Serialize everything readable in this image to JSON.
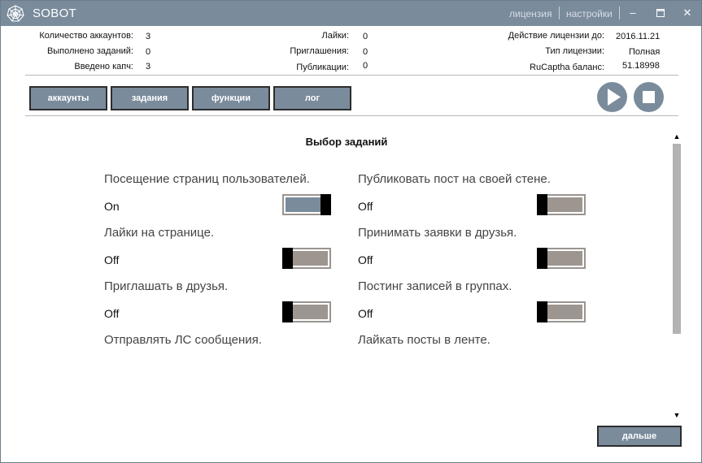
{
  "window": {
    "title": "SOBOT",
    "links": {
      "license": "лицензия",
      "settings": "настройки"
    }
  },
  "stats": {
    "accounts_label": "Количество аккаунтов:",
    "accounts_value": "3",
    "tasks_done_label": "Выполнено заданий:",
    "tasks_done_value": "0",
    "captchas_label": "Введено капч:",
    "captchas_value": "3",
    "likes_label": "Лайки:",
    "likes_value": "0",
    "invites_label": "Приглашения:",
    "invites_value": "0",
    "posts_label": "Публикации:",
    "posts_value": "0",
    "license_until_label": "Действие лицензии до:",
    "license_until_value": "2016.11.21",
    "license_type_label": "Тип лицензии:",
    "license_type_value": "Полная",
    "rucaptcha_label": "RuCaptha баланс:",
    "rucaptcha_value": "51.18998"
  },
  "nav": {
    "accounts": "аккаунты",
    "tasks": "задания",
    "functions": "функции",
    "log": "лог"
  },
  "controls": {
    "play_icon": "play-icon",
    "stop_icon": "stop-icon"
  },
  "content": {
    "title": "Выбор заданий",
    "tasks": [
      {
        "label": "Посещение страниц пользователей.",
        "state": "On"
      },
      {
        "label": "Публиковать пост на своей стене.",
        "state": "Off"
      },
      {
        "label": "Лайки на странице.",
        "state": "Off"
      },
      {
        "label": "Принимать заявки в друзья.",
        "state": "Off"
      },
      {
        "label": "Приглашать в друзья.",
        "state": "Off"
      },
      {
        "label": "Постинг записей в группах.",
        "state": "Off"
      },
      {
        "label": "Отправлять ЛС сообщения.",
        "state": ""
      },
      {
        "label": "Лайкать посты в ленте.",
        "state": ""
      }
    ]
  },
  "footer": {
    "next": "дальше"
  },
  "colors": {
    "accent": "#7a8b9c",
    "toggle_off": "#9d958f",
    "border": "#2d2d2d"
  }
}
